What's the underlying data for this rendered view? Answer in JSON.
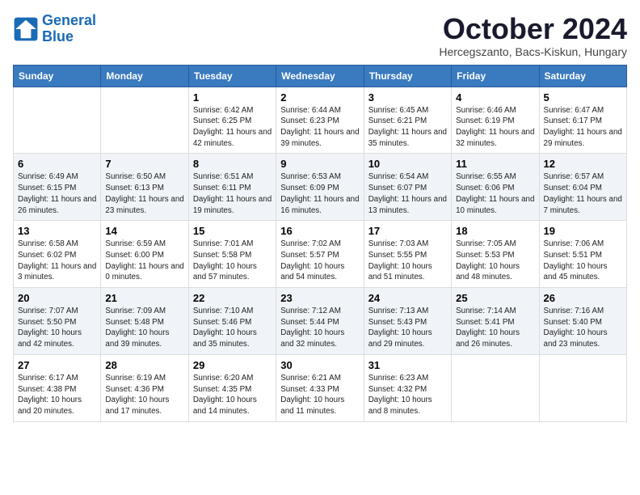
{
  "header": {
    "logo_line1": "General",
    "logo_line2": "Blue",
    "month_title": "October 2024",
    "subtitle": "Hercegszanto, Bacs-Kiskun, Hungary"
  },
  "weekdays": [
    "Sunday",
    "Monday",
    "Tuesday",
    "Wednesday",
    "Thursday",
    "Friday",
    "Saturday"
  ],
  "weeks": [
    [
      {
        "day": "",
        "info": ""
      },
      {
        "day": "",
        "info": ""
      },
      {
        "day": "1",
        "info": "Sunrise: 6:42 AM\nSunset: 6:25 PM\nDaylight: 11 hours and 42 minutes."
      },
      {
        "day": "2",
        "info": "Sunrise: 6:44 AM\nSunset: 6:23 PM\nDaylight: 11 hours and 39 minutes."
      },
      {
        "day": "3",
        "info": "Sunrise: 6:45 AM\nSunset: 6:21 PM\nDaylight: 11 hours and 35 minutes."
      },
      {
        "day": "4",
        "info": "Sunrise: 6:46 AM\nSunset: 6:19 PM\nDaylight: 11 hours and 32 minutes."
      },
      {
        "day": "5",
        "info": "Sunrise: 6:47 AM\nSunset: 6:17 PM\nDaylight: 11 hours and 29 minutes."
      }
    ],
    [
      {
        "day": "6",
        "info": "Sunrise: 6:49 AM\nSunset: 6:15 PM\nDaylight: 11 hours and 26 minutes."
      },
      {
        "day": "7",
        "info": "Sunrise: 6:50 AM\nSunset: 6:13 PM\nDaylight: 11 hours and 23 minutes."
      },
      {
        "day": "8",
        "info": "Sunrise: 6:51 AM\nSunset: 6:11 PM\nDaylight: 11 hours and 19 minutes."
      },
      {
        "day": "9",
        "info": "Sunrise: 6:53 AM\nSunset: 6:09 PM\nDaylight: 11 hours and 16 minutes."
      },
      {
        "day": "10",
        "info": "Sunrise: 6:54 AM\nSunset: 6:07 PM\nDaylight: 11 hours and 13 minutes."
      },
      {
        "day": "11",
        "info": "Sunrise: 6:55 AM\nSunset: 6:06 PM\nDaylight: 11 hours and 10 minutes."
      },
      {
        "day": "12",
        "info": "Sunrise: 6:57 AM\nSunset: 6:04 PM\nDaylight: 11 hours and 7 minutes."
      }
    ],
    [
      {
        "day": "13",
        "info": "Sunrise: 6:58 AM\nSunset: 6:02 PM\nDaylight: 11 hours and 3 minutes."
      },
      {
        "day": "14",
        "info": "Sunrise: 6:59 AM\nSunset: 6:00 PM\nDaylight: 11 hours and 0 minutes."
      },
      {
        "day": "15",
        "info": "Sunrise: 7:01 AM\nSunset: 5:58 PM\nDaylight: 10 hours and 57 minutes."
      },
      {
        "day": "16",
        "info": "Sunrise: 7:02 AM\nSunset: 5:57 PM\nDaylight: 10 hours and 54 minutes."
      },
      {
        "day": "17",
        "info": "Sunrise: 7:03 AM\nSunset: 5:55 PM\nDaylight: 10 hours and 51 minutes."
      },
      {
        "day": "18",
        "info": "Sunrise: 7:05 AM\nSunset: 5:53 PM\nDaylight: 10 hours and 48 minutes."
      },
      {
        "day": "19",
        "info": "Sunrise: 7:06 AM\nSunset: 5:51 PM\nDaylight: 10 hours and 45 minutes."
      }
    ],
    [
      {
        "day": "20",
        "info": "Sunrise: 7:07 AM\nSunset: 5:50 PM\nDaylight: 10 hours and 42 minutes."
      },
      {
        "day": "21",
        "info": "Sunrise: 7:09 AM\nSunset: 5:48 PM\nDaylight: 10 hours and 39 minutes."
      },
      {
        "day": "22",
        "info": "Sunrise: 7:10 AM\nSunset: 5:46 PM\nDaylight: 10 hours and 35 minutes."
      },
      {
        "day": "23",
        "info": "Sunrise: 7:12 AM\nSunset: 5:44 PM\nDaylight: 10 hours and 32 minutes."
      },
      {
        "day": "24",
        "info": "Sunrise: 7:13 AM\nSunset: 5:43 PM\nDaylight: 10 hours and 29 minutes."
      },
      {
        "day": "25",
        "info": "Sunrise: 7:14 AM\nSunset: 5:41 PM\nDaylight: 10 hours and 26 minutes."
      },
      {
        "day": "26",
        "info": "Sunrise: 7:16 AM\nSunset: 5:40 PM\nDaylight: 10 hours and 23 minutes."
      }
    ],
    [
      {
        "day": "27",
        "info": "Sunrise: 6:17 AM\nSunset: 4:38 PM\nDaylight: 10 hours and 20 minutes."
      },
      {
        "day": "28",
        "info": "Sunrise: 6:19 AM\nSunset: 4:36 PM\nDaylight: 10 hours and 17 minutes."
      },
      {
        "day": "29",
        "info": "Sunrise: 6:20 AM\nSunset: 4:35 PM\nDaylight: 10 hours and 14 minutes."
      },
      {
        "day": "30",
        "info": "Sunrise: 6:21 AM\nSunset: 4:33 PM\nDaylight: 10 hours and 11 minutes."
      },
      {
        "day": "31",
        "info": "Sunrise: 6:23 AM\nSunset: 4:32 PM\nDaylight: 10 hours and 8 minutes."
      },
      {
        "day": "",
        "info": ""
      },
      {
        "day": "",
        "info": ""
      }
    ]
  ]
}
